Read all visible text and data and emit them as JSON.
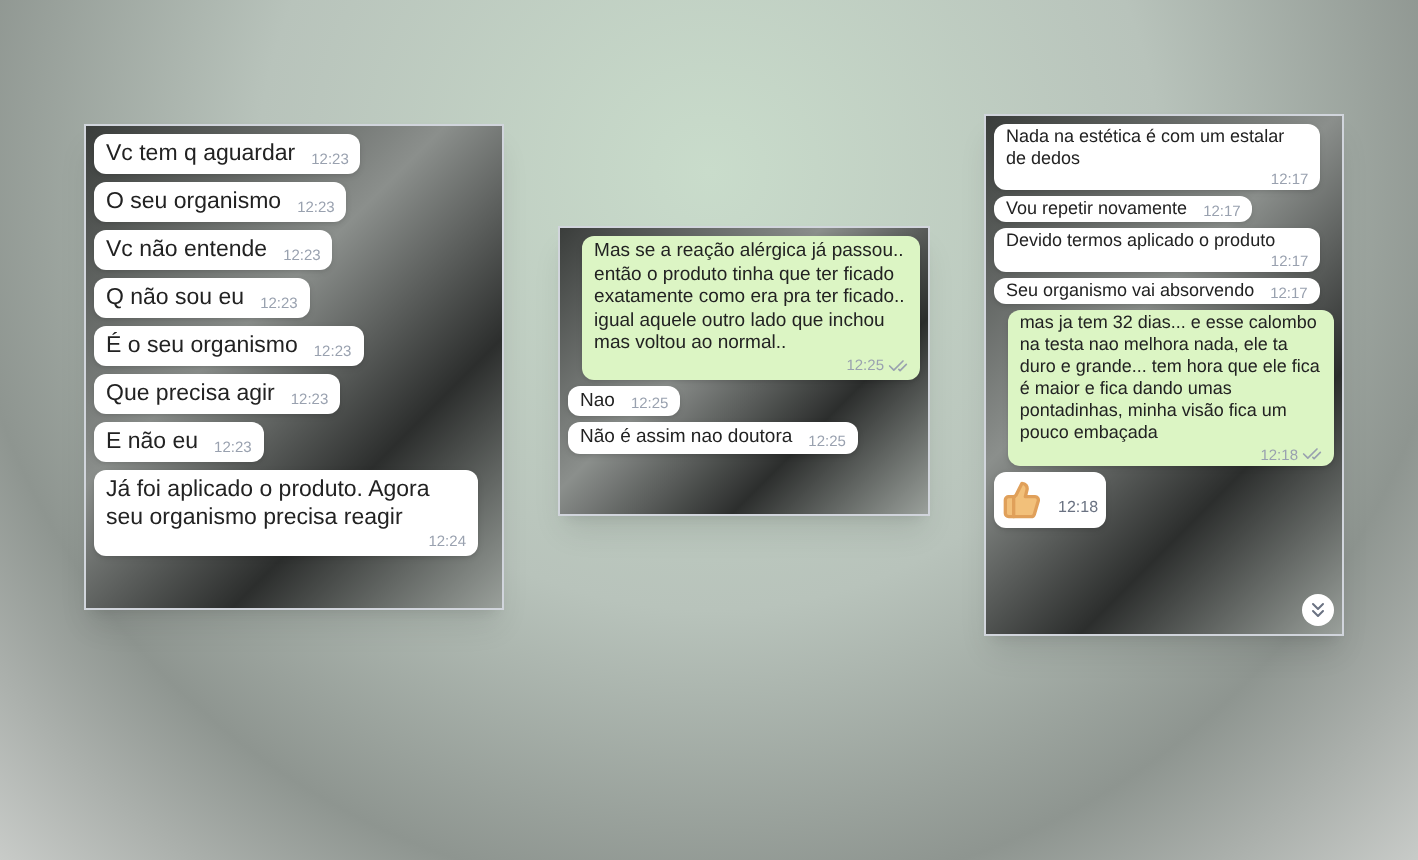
{
  "chats": [
    {
      "messages": [
        {
          "kind": "incoming",
          "text": "Vc tem q aguardar",
          "time": "12:23"
        },
        {
          "kind": "incoming",
          "text": "O seu organismo",
          "time": "12:23"
        },
        {
          "kind": "incoming",
          "text": "Vc não entende",
          "time": "12:23"
        },
        {
          "kind": "incoming",
          "text": "Q não sou eu",
          "time": "12:23"
        },
        {
          "kind": "incoming",
          "text": "É o seu organismo",
          "time": "12:23"
        },
        {
          "kind": "incoming",
          "text": "Que precisa agir",
          "time": "12:23"
        },
        {
          "kind": "incoming",
          "text": "E não eu",
          "time": "12:23"
        },
        {
          "kind": "incoming",
          "text": "Já foi aplicado o produto. Agora seu organismo precisa reagir",
          "time": "12:24"
        }
      ]
    },
    {
      "messages": [
        {
          "kind": "outgoing",
          "text": "Mas se a reação alérgica já passou.. então o produto tinha que ter ficado exatamente como era pra ter ficado.. igual aquele outro lado que inchou mas voltou ao normal..",
          "time": "12:25",
          "read": true
        },
        {
          "kind": "incoming",
          "text": "Nao",
          "time": "12:25"
        },
        {
          "kind": "incoming",
          "text": "Não é assim nao doutora",
          "time": "12:25"
        }
      ]
    },
    {
      "messages": [
        {
          "kind": "incoming",
          "text": "Nada na estética é com um estalar de dedos",
          "time": "12:17"
        },
        {
          "kind": "incoming",
          "text": "Vou repetir novamente",
          "time": "12:17"
        },
        {
          "kind": "incoming",
          "text": "Devido termos aplicado o produto",
          "time": "12:17"
        },
        {
          "kind": "incoming",
          "text": "Seu organismo vai absorvendo",
          "time": "12:17"
        },
        {
          "kind": "outgoing",
          "text": "mas ja tem 32 dias... e esse calombo na testa nao melhora nada, ele ta duro e grande... tem hora que ele fica é maior e fica dando umas pontadinhas, minha visão fica um pouco embaçada",
          "time": "12:18",
          "read": true
        },
        {
          "kind": "thumb",
          "time": "12:18"
        }
      ],
      "scroll_button": true
    }
  ]
}
